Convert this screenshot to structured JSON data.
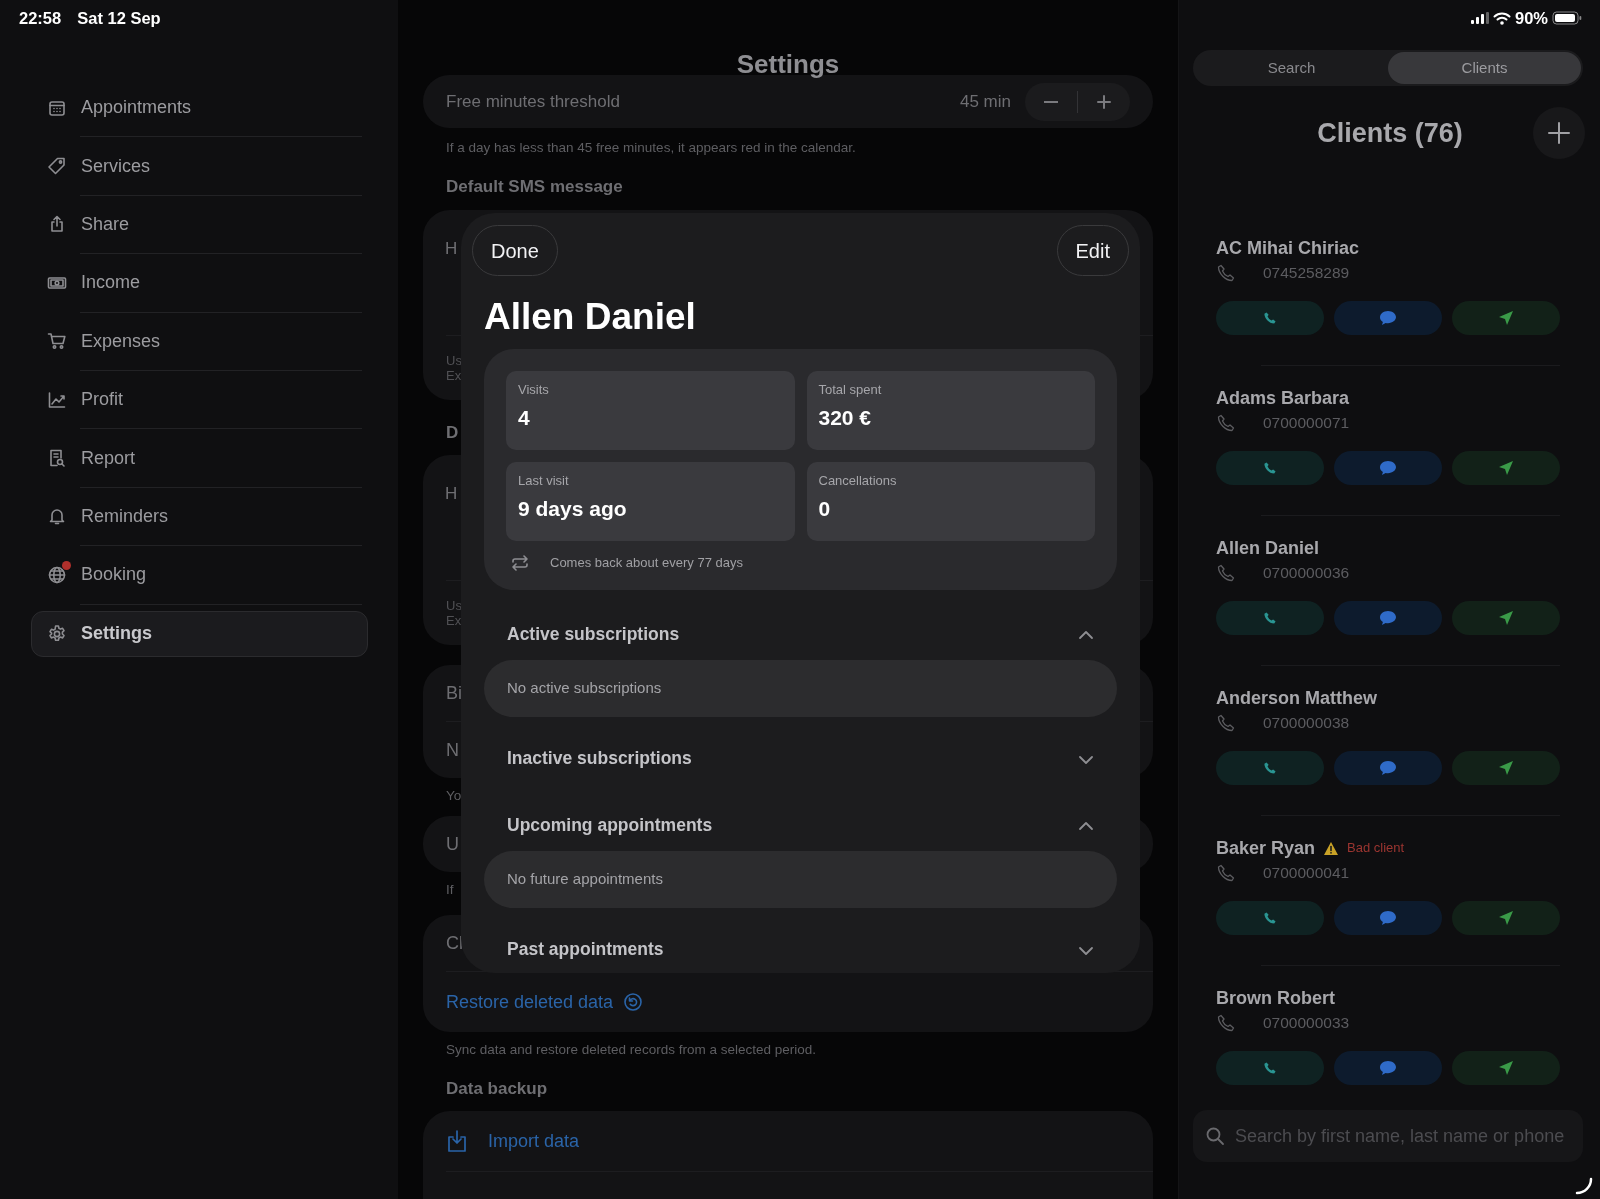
{
  "status_bar": {
    "time": "22:58",
    "date": "Sat 12 Sep",
    "battery": "90%"
  },
  "sidebar": {
    "items": [
      {
        "label": "Appointments",
        "selected": false,
        "notification": false
      },
      {
        "label": "Services",
        "selected": false,
        "notification": false
      },
      {
        "label": "Share",
        "selected": false,
        "notification": false
      },
      {
        "label": "Income",
        "selected": false,
        "notification": false
      },
      {
        "label": "Expenses",
        "selected": false,
        "notification": false
      },
      {
        "label": "Profit",
        "selected": false,
        "notification": false
      },
      {
        "label": "Report",
        "selected": false,
        "notification": false
      },
      {
        "label": "Reminders",
        "selected": false,
        "notification": false
      },
      {
        "label": "Booking",
        "selected": false,
        "notification": true
      },
      {
        "label": "Settings",
        "selected": true,
        "notification": false
      }
    ]
  },
  "settings": {
    "title": "Settings",
    "blocks": [
      {
        "kind": "stepper",
        "label": "Free minutes threshold",
        "value": "45 min"
      },
      {
        "kind": "caption",
        "text": "If a day has less than 45 free minutes, it appears red in the calendar."
      },
      {
        "kind": "header",
        "text": "Default SMS message"
      },
      {
        "kind": "card",
        "rows": [
          {
            "kind": "textarea",
            "text": "H"
          },
          {
            "kind": "note",
            "lines": [
              "Us",
              "Ex"
            ]
          }
        ]
      },
      {
        "kind": "header",
        "text": "D"
      },
      {
        "kind": "card",
        "rows": [
          {
            "kind": "textarea",
            "text": "H"
          },
          {
            "kind": "note",
            "lines": [
              "Us",
              "Ex"
            ]
          }
        ]
      },
      {
        "kind": "card",
        "rows": [
          {
            "kind": "label",
            "text": "Bi"
          },
          {
            "kind": "label",
            "text": "N"
          }
        ]
      },
      {
        "kind": "caption",
        "text": "Yo"
      },
      {
        "kind": "card",
        "rows": [
          {
            "kind": "label",
            "text": "U"
          }
        ]
      },
      {
        "kind": "caption",
        "text": "If"
      },
      {
        "kind": "card",
        "rows": [
          {
            "kind": "label",
            "text": "Cl"
          },
          {
            "kind": "link",
            "text": "Restore deleted data"
          }
        ]
      },
      {
        "kind": "caption",
        "text": "Sync data and restore deleted records from a selected period."
      },
      {
        "kind": "header",
        "text": "Data backup"
      },
      {
        "kind": "card",
        "rows": [
          {
            "kind": "icon-link",
            "text": "Import data"
          },
          {
            "kind": "blank"
          }
        ]
      }
    ]
  },
  "modal": {
    "done": "Done",
    "edit": "Edit",
    "name": "Allen Daniel",
    "stats": [
      {
        "label": "Visits",
        "value": "4"
      },
      {
        "label": "Total spent",
        "value": "320 €"
      },
      {
        "label": "Last visit",
        "value": "9 days ago"
      },
      {
        "label": "Cancellations",
        "value": "0"
      }
    ],
    "return_note": "Comes back about every 77 days",
    "sections": [
      {
        "title": "Active subscriptions",
        "expanded": true,
        "empty_text": "No active subscriptions"
      },
      {
        "title": "Inactive subscriptions",
        "expanded": false
      },
      {
        "title": "Upcoming appointments",
        "expanded": true,
        "empty_text": "No future appointments"
      },
      {
        "title": "Past appointments",
        "expanded": false
      }
    ]
  },
  "clients_panel": {
    "tabs": [
      {
        "label": "Search",
        "selected": false
      },
      {
        "label": "Clients",
        "selected": true
      }
    ],
    "title": "Clients (76)",
    "clients": [
      {
        "name": "AC Mihai Chiriac",
        "phone": "0745258289"
      },
      {
        "name": "Adams Barbara",
        "phone": "0700000071"
      },
      {
        "name": "Allen Daniel",
        "phone": "0700000036"
      },
      {
        "name": "Anderson Matthew",
        "phone": "0700000038"
      },
      {
        "name": "Baker Ryan",
        "flag": "Bad client",
        "phone": "0700000041"
      },
      {
        "name": "Brown Robert",
        "phone": "0700000033"
      }
    ],
    "search": {
      "placeholder": "Search by first name, last name or phone"
    }
  }
}
